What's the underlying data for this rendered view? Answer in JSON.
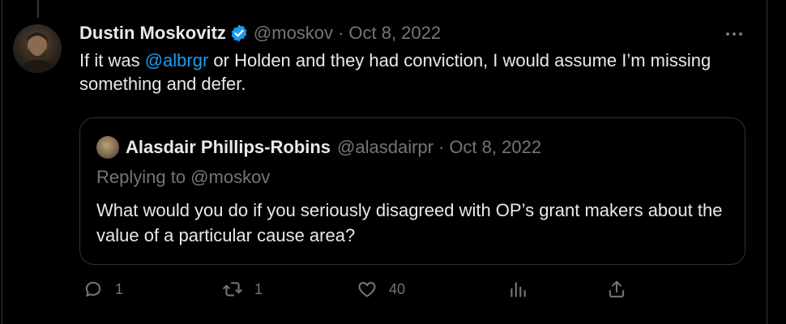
{
  "tweet": {
    "name": "Dustin Moskovitz",
    "handle": "@moskov",
    "separator": "·",
    "date": "Oct 8, 2022",
    "text_before": "If it was ",
    "mention": "@albrgr",
    "text_after": " or Holden and they had conviction, I would assume I’m missing something and defer."
  },
  "quote": {
    "name": "Alasdair Phillips-Robins",
    "handle": "@alasdairpr",
    "separator": "·",
    "date": "Oct 8, 2022",
    "replying_to": "Replying to @moskov",
    "text": "What would you do if you seriously disagreed with OP’s grant makers about the value of a particular cause area?"
  },
  "actions": {
    "replies": "1",
    "retweets": "1",
    "likes": "40"
  },
  "colors": {
    "background": "#000000",
    "text": "#e7e9ea",
    "muted": "#71767b",
    "accent": "#1d9bf0",
    "border": "#2f3336"
  },
  "icons": [
    "verified-badge-icon",
    "more-icon",
    "reply-icon",
    "retweet-icon",
    "like-icon",
    "views-icon",
    "share-icon"
  ]
}
